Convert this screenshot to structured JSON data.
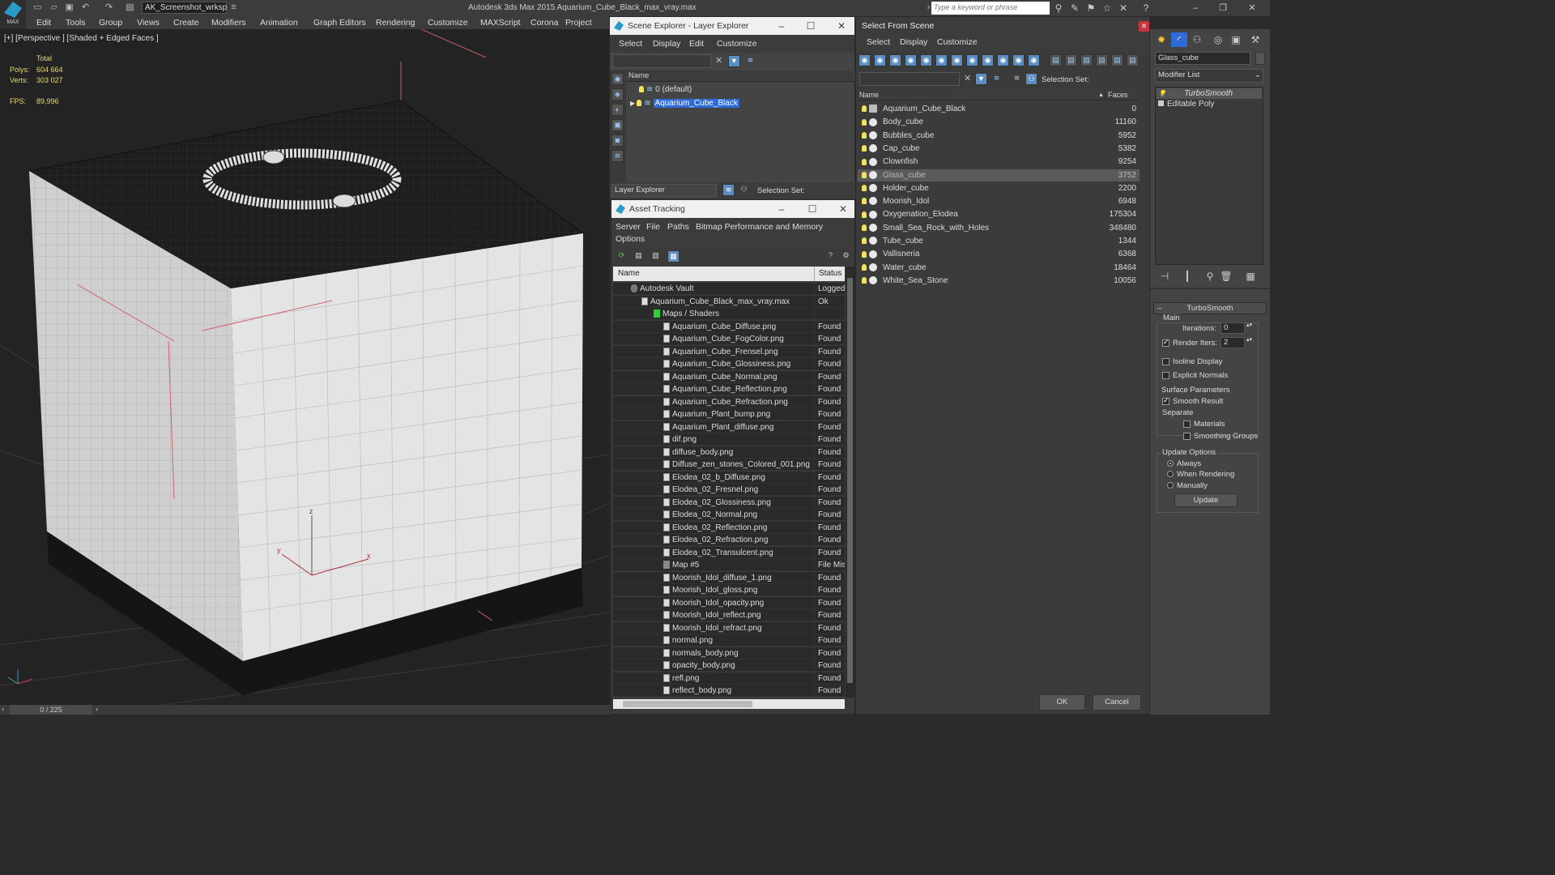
{
  "app": {
    "logo_text": "MAX",
    "workspace": "AK_Screenshot_wrksp",
    "title": "Autodesk 3ds Max  2015     Aquarium_Cube_Black_max_vray.max",
    "search_placeholder": "Type a keyword or phrase"
  },
  "menubar": [
    "Edit",
    "Tools",
    "Group",
    "Views",
    "Create",
    "Modifiers",
    "Animation",
    "Graph Editors",
    "Rendering",
    "Customize",
    "MAXScript",
    "Corona",
    "Project Man"
  ],
  "viewport": {
    "label": "[+] [Perspective ] [Shaded + Edged Faces ]",
    "stats_total": "Total",
    "polys_label": "Polys:",
    "polys_value": "604 664",
    "verts_label": "Verts:",
    "verts_value": "303 027",
    "fps_label": "FPS:",
    "fps_value": "89,996",
    "axis_x": "x",
    "axis_y": "y",
    "axis_z": "z"
  },
  "timeslider": "0 / 225",
  "scene_explorer": {
    "title": "Scene Explorer - Layer Explorer",
    "menu": [
      "Select",
      "Display",
      "Edit",
      "Customize"
    ],
    "col_name": "Name",
    "rows": [
      "0 (default)",
      "Aquarium_Cube_Black"
    ],
    "footer_dropdown": "Layer Explorer",
    "selection_set": "Selection Set:"
  },
  "asset_tracking": {
    "title": "Asset Tracking",
    "menu": [
      "Server",
      "File",
      "Paths",
      "Bitmap Performance and Memory",
      "Options"
    ],
    "col_name": "Name",
    "col_status": "Status",
    "rows": [
      {
        "name": "Autodesk Vault",
        "status": "Logged",
        "level": 0
      },
      {
        "name": "Aquarium_Cube_Black_max_vray.max",
        "status": "Ok",
        "level": 1
      },
      {
        "name": "Maps / Shaders",
        "status": "",
        "level": 2
      },
      {
        "name": "Aquarium_Cube_Diffuse.png",
        "status": "Found",
        "level": 3
      },
      {
        "name": "Aquarium_Cube_FogColor.png",
        "status": "Found",
        "level": 3
      },
      {
        "name": "Aquarium_Cube_Frensel.png",
        "status": "Found",
        "level": 3
      },
      {
        "name": "Aquarium_Cube_Glossiness.png",
        "status": "Found",
        "level": 3
      },
      {
        "name": "Aquarium_Cube_Normal.png",
        "status": "Found",
        "level": 3
      },
      {
        "name": "Aquarium_Cube_Reflection.png",
        "status": "Found",
        "level": 3
      },
      {
        "name": "Aquarium_Cube_Refraction.png",
        "status": "Found",
        "level": 3
      },
      {
        "name": "Aquarium_Plant_bump.png",
        "status": "Found",
        "level": 3
      },
      {
        "name": "Aquarium_Plant_diffuse.png",
        "status": "Found",
        "level": 3
      },
      {
        "name": "dif.png",
        "status": "Found",
        "level": 3
      },
      {
        "name": "diffuse_body.png",
        "status": "Found",
        "level": 3
      },
      {
        "name": "Diffuse_zen_stones_Colored_001.png",
        "status": "Found",
        "level": 3
      },
      {
        "name": "Elodea_02_b_Diffuse.png",
        "status": "Found",
        "level": 3
      },
      {
        "name": "Elodea_02_Fresnel.png",
        "status": "Found",
        "level": 3
      },
      {
        "name": "Elodea_02_Glossiness.png",
        "status": "Found",
        "level": 3
      },
      {
        "name": "Elodea_02_Normal.png",
        "status": "Found",
        "level": 3
      },
      {
        "name": "Elodea_02_Reflection.png",
        "status": "Found",
        "level": 3
      },
      {
        "name": "Elodea_02_Refraction.png",
        "status": "Found",
        "level": 3
      },
      {
        "name": "Elodea_02_Transulcent.png",
        "status": "Found",
        "level": 3
      },
      {
        "name": "Map #5",
        "status": "File Mis",
        "level": 3
      },
      {
        "name": "Moorish_Idol_diffuse_1.png",
        "status": "Found",
        "level": 3
      },
      {
        "name": "Moorish_Idol_gloss.png",
        "status": "Found",
        "level": 3
      },
      {
        "name": "Moorish_Idol_opacity.png",
        "status": "Found",
        "level": 3
      },
      {
        "name": "Moorish_Idol_reflect.png",
        "status": "Found",
        "level": 3
      },
      {
        "name": "Moorish_Idol_refract.png",
        "status": "Found",
        "level": 3
      },
      {
        "name": "normal.png",
        "status": "Found",
        "level": 3
      },
      {
        "name": "normals_body.png",
        "status": "Found",
        "level": 3
      },
      {
        "name": "opacity_body.png",
        "status": "Found",
        "level": 3
      },
      {
        "name": "refl.png",
        "status": "Found",
        "level": 3
      },
      {
        "name": "reflect_body.png",
        "status": "Found",
        "level": 3
      }
    ]
  },
  "select_from_scene": {
    "title": "Select From Scene",
    "menu": [
      "Select",
      "Display",
      "Customize"
    ],
    "selection_set": "Selection Set:",
    "col_name": "Name",
    "col_faces": "Faces",
    "rows": [
      {
        "name": "Aquarium_Cube_Black",
        "faces": "0"
      },
      {
        "name": "Body_cube",
        "faces": "11160"
      },
      {
        "name": "Bubbles_cube",
        "faces": "5952"
      },
      {
        "name": "Cap_cube",
        "faces": "5382"
      },
      {
        "name": "Clownfish",
        "faces": "9254"
      },
      {
        "name": "Glass_cube",
        "faces": "3752"
      },
      {
        "name": "Holder_cube",
        "faces": "2200"
      },
      {
        "name": "Moorish_Idol",
        "faces": "6948"
      },
      {
        "name": "Oxygenation_Elodea",
        "faces": "175304"
      },
      {
        "name": "Small_Sea_Rock_with_Holes",
        "faces": "348480"
      },
      {
        "name": "Tube_cube",
        "faces": "1344"
      },
      {
        "name": "Vallisneria",
        "faces": "6368"
      },
      {
        "name": "Water_cube",
        "faces": "18464"
      },
      {
        "name": "White_Sea_Stone",
        "faces": "10056"
      }
    ],
    "selected_index": 5,
    "ok": "OK",
    "cancel": "Cancel"
  },
  "command_panel": {
    "object_name": "Glass_cube",
    "modifier_list": "Modifier List",
    "stack": [
      "TurboSmooth",
      "Editable Poly"
    ],
    "rollout_title": "TurboSmooth",
    "main": "Main",
    "iterations_label": "Iterations:",
    "iterations_value": "0",
    "render_iters_label": "Render Iters:",
    "render_iters_value": "2",
    "isoline": "Isoline Display",
    "explicit_normals": "Explicit Normals",
    "surface_params": "Surface Parameters",
    "smooth_result": "Smooth Result",
    "separate": "Separate",
    "materials": "Materials",
    "smoothing_groups": "Smoothing Groups",
    "update_options": "Update Options",
    "always": "Always",
    "when_rendering": "When Rendering",
    "manually": "Manually",
    "update": "Update"
  }
}
